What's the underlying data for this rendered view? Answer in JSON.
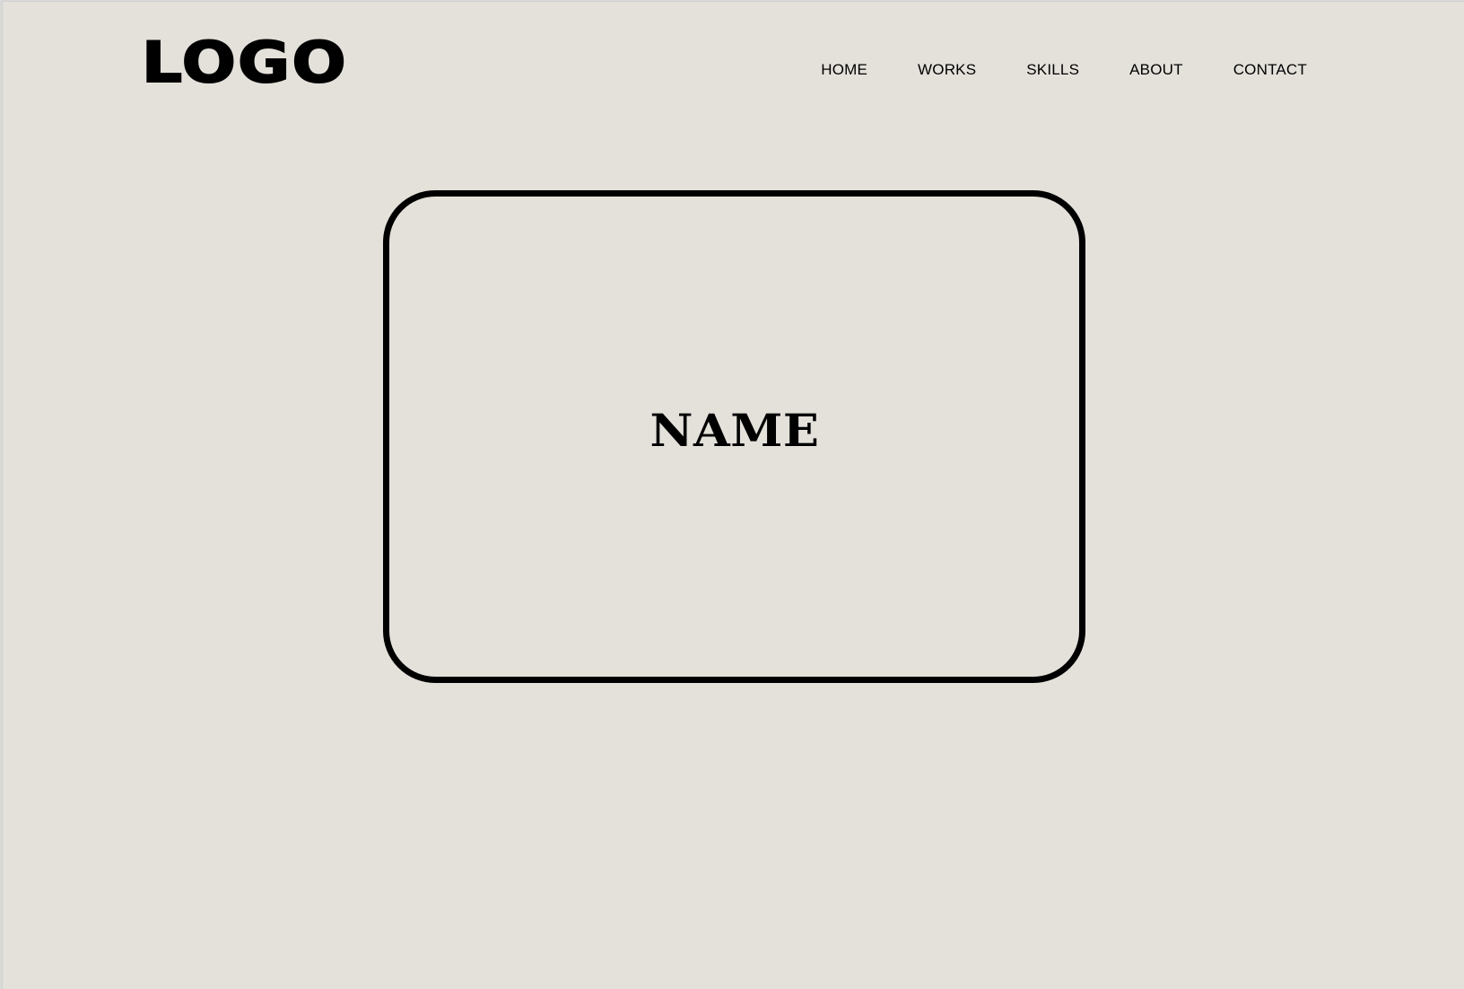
{
  "header": {
    "logo_text": "LOGO",
    "nav": [
      {
        "label": "HOME"
      },
      {
        "label": "WORKS"
      },
      {
        "label": "SKILLS"
      },
      {
        "label": "ABOUT"
      },
      {
        "label": "CONTACT"
      }
    ]
  },
  "hero": {
    "name": "NAME"
  },
  "colors": {
    "background": "#e4e1db",
    "text": "#000000",
    "card_border": "#000000"
  }
}
